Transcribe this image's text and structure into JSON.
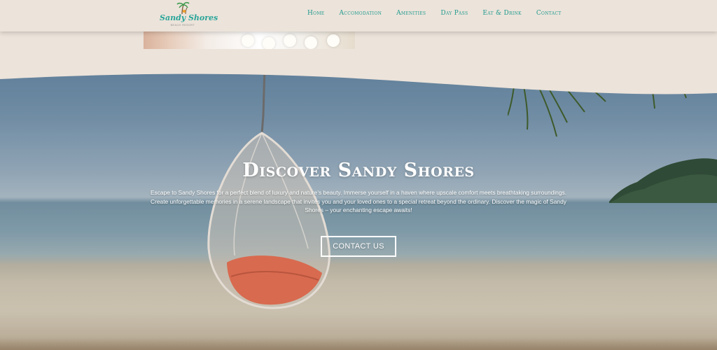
{
  "brand": {
    "name": "Sandy Shores",
    "tagline": "BEACH RESORT"
  },
  "nav": {
    "items": [
      {
        "label": "Home"
      },
      {
        "label": "Accomodation"
      },
      {
        "label": "Amenities"
      },
      {
        "label": "Day Pass"
      },
      {
        "label": "Eat & Drink"
      },
      {
        "label": "Contact"
      }
    ]
  },
  "hero": {
    "title": "Discover Sandy Shores",
    "text": "Escape to Sandy Shores for a perfect blend of luxury and nature's beauty. Immerse yourself in a haven where upscale comfort meets breathtaking surroundings. Create unforgettable memories in a serene landscape that invites you and your loved ones to a special retreat beyond the ordinary. Discover the magic of Sandy Shores – your enchanting escape awaits!",
    "cta_label": "CONTACT US"
  },
  "colors": {
    "background": "#ece3da",
    "accent": "#1f9a8e",
    "logo_teal": "#2aa59a"
  }
}
